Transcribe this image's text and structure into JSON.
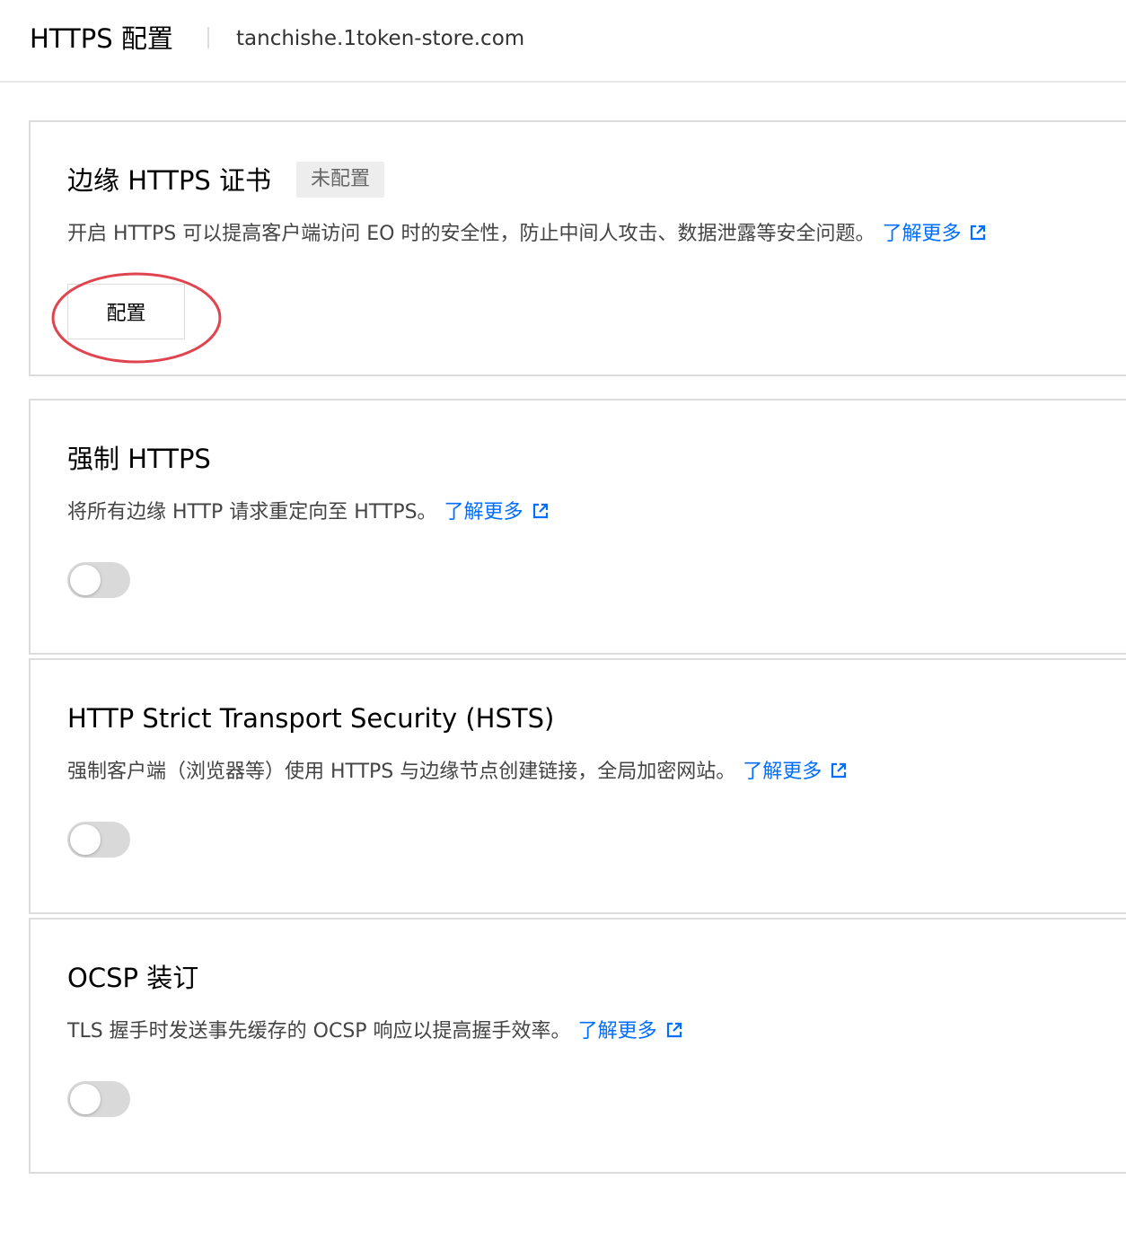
{
  "header": {
    "title": "HTTPS 配置",
    "domain": "tanchishe.1token-store.com"
  },
  "sections": [
    {
      "title": "边缘 HTTPS 证书",
      "status": "未配置",
      "description": "开启 HTTPS 可以提高客户端访问 EO 时的安全性，防止中间人攻击、数据泄露等安全问题。",
      "learn_more": "了解更多",
      "button_label": "配置"
    },
    {
      "title": "强制 HTTPS",
      "description": "将所有边缘 HTTP 请求重定向至 HTTPS。",
      "learn_more": "了解更多",
      "enabled": false
    },
    {
      "title": "HTTP Strict Transport Security (HSTS)",
      "description": "强制客户端（浏览器等）使用 HTTPS 与边缘节点创建链接，全局加密网站。",
      "learn_more": "了解更多",
      "enabled": false
    },
    {
      "title": "OCSP 装订",
      "description": "TLS 握手时发送事先缓存的 OCSP 响应以提高握手效率。",
      "learn_more": "了解更多",
      "enabled": false
    }
  ],
  "icons": {
    "external_link": "external-link-icon"
  },
  "colors": {
    "link": "#006eff",
    "highlight_ring": "#e0454f",
    "toggle_off": "#d9d9d9",
    "tag_bg": "#ededed",
    "border": "#dcdcdc"
  }
}
